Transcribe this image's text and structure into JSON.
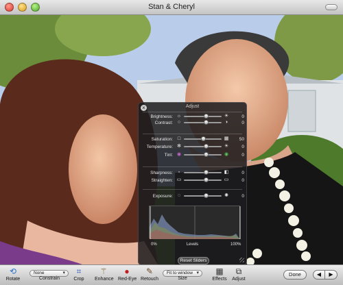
{
  "window": {
    "title": "Stan & Cheryl"
  },
  "adjust": {
    "title": "Adjust",
    "sliders": [
      {
        "name": "brightness",
        "label": "Brightness:",
        "value": "0",
        "level": 0.58,
        "icon_left": "sun-small-icon",
        "icon_right": "sun-large-icon",
        "left_glyph": "☼",
        "right_glyph": "☀"
      },
      {
        "name": "contrast",
        "label": "Contrast:",
        "value": "0",
        "level": 0.58,
        "icon_left": "contrast-low-icon",
        "icon_right": "contrast-high-icon",
        "left_glyph": "○",
        "right_glyph": "◑"
      },
      {
        "name": "saturation",
        "label": "Saturation:",
        "value": "50",
        "level": 0.5,
        "icon_left": "saturation-low-icon",
        "icon_right": "saturation-high-icon",
        "left_glyph": "□",
        "right_glyph": "▦"
      },
      {
        "name": "temperature",
        "label": "Temperature:",
        "value": "0",
        "level": 0.58,
        "icon_left": "cool-icon",
        "icon_right": "warm-icon",
        "left_glyph": "✻",
        "right_glyph": "☀"
      },
      {
        "name": "tint",
        "label": "Tint:",
        "value": "0",
        "level": 0.58,
        "icon_left": "tint-magenta-icon",
        "icon_right": "tint-green-icon",
        "left_glyph": "◉",
        "right_glyph": "◉"
      },
      {
        "name": "sharpness",
        "label": "Sharpness:",
        "value": "0",
        "level": 0.58,
        "icon_left": "soft-icon",
        "icon_right": "sharp-icon",
        "left_glyph": "▫",
        "right_glyph": "◧"
      },
      {
        "name": "straighten",
        "label": "Straighten:",
        "value": "0",
        "level": 0.58,
        "icon_left": "rotate-left-icon",
        "icon_right": "rotate-right-icon",
        "left_glyph": "▭",
        "right_glyph": "▭"
      },
      {
        "name": "exposure",
        "label": "Exposure:",
        "value": "0",
        "level": 0.58,
        "icon_left": "exposure-low-icon",
        "icon_right": "exposure-high-icon",
        "left_glyph": "◌",
        "right_glyph": "✺"
      }
    ],
    "levels_min": "0%",
    "levels_label": "Levels",
    "levels_max": "100%",
    "reset_label": "Reset Sliders"
  },
  "toolbar": {
    "rotate": "Rotate",
    "constrain_value": "None",
    "constrain": "Constrain",
    "crop": "Crop",
    "enhance": "Enhance",
    "red_eye": "Red-Eye",
    "retouch": "Retouch",
    "size_value": "Fit to window",
    "size": "Size",
    "effects": "Effects",
    "adjust": "Adjust",
    "done": "Done",
    "prev_glyph": "◀",
    "next_glyph": "▶"
  }
}
